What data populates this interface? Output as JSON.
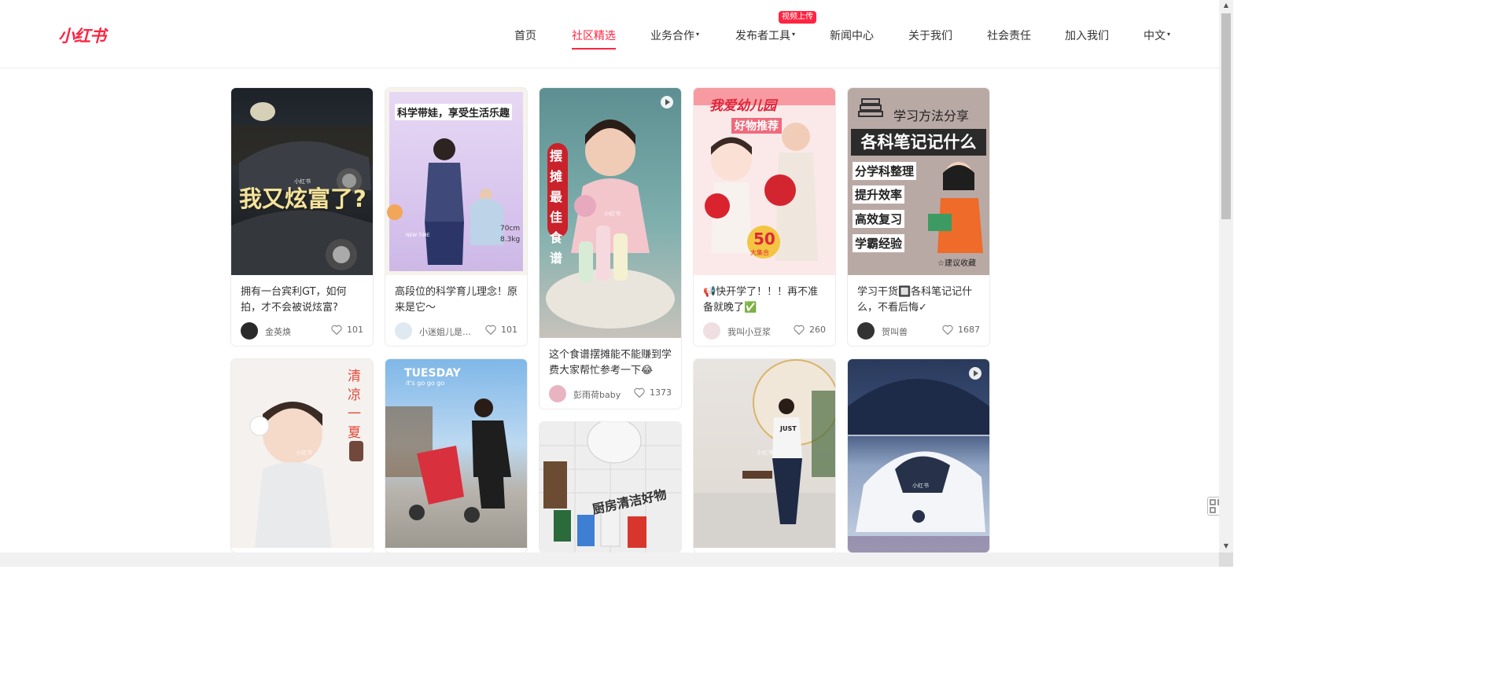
{
  "brand": {
    "logo": "小红书",
    "accent": "#ff2442"
  },
  "nav": {
    "home": "首页",
    "community": "社区精选",
    "business": "业务合作",
    "publisher": "发布者工具",
    "publisher_badge": "视频上传",
    "news": "新闻中心",
    "about": "关于我们",
    "social": "社会责任",
    "join": "加入我们",
    "lang": "中文",
    "caret": "▾"
  },
  "cards": [
    {
      "title": "拥有一台宾利GT，如何拍，才不会被说炫富?",
      "author": "金英焕",
      "likes": "101",
      "cover_text": "我又炫富了?",
      "watermark": "小红书"
    },
    {
      "title": "高段位的科学育儿理念！原来是它～",
      "author": "小迷姐儿是豆...",
      "likes": "101",
      "cover_text": "科学带娃，享受生活乐趣",
      "cover_sub1": "70cm",
      "cover_sub2": "8.3kg",
      "cover_sub3": "NEW TIME"
    },
    {
      "title": "这个食谱摆摊能不能赚到学费大家帮忙参考一下😂",
      "author": "彭雨荷baby",
      "likes": "1373",
      "cover_text": "摆摊最佳食谱",
      "watermark": "小红书"
    },
    {
      "title": "📢快开学了！！！再不准备就晚了✅",
      "author": "我叫小豆浆",
      "likes": "260",
      "cover_text": "我爱幼儿园",
      "cover_sub1": "好物推荐",
      "cover_sub2": "50",
      "cover_sub3": "大集合"
    },
    {
      "title": "学习干货🔲各科笔记记什么，不看后悔✓",
      "author": "贺叫兽",
      "likes": "1687",
      "cover_text": "学习方法分享",
      "cover_banner": "各科笔记记什么",
      "cover_lines": [
        "分学科整理",
        "提升效率",
        "高效复习",
        "学霸经验"
      ],
      "cover_foot": "☆建议收藏"
    },
    {
      "cover_text": "清凉一夏",
      "watermark": "小红书"
    },
    {
      "cover_text": "TUESDAY",
      "cover_sub1": "it's go go go"
    },
    {
      "cover_text": "厨房清洁好物"
    },
    {
      "watermark": "小红书",
      "cover_text": "JUST"
    },
    {
      "watermark": "小红书"
    }
  ]
}
